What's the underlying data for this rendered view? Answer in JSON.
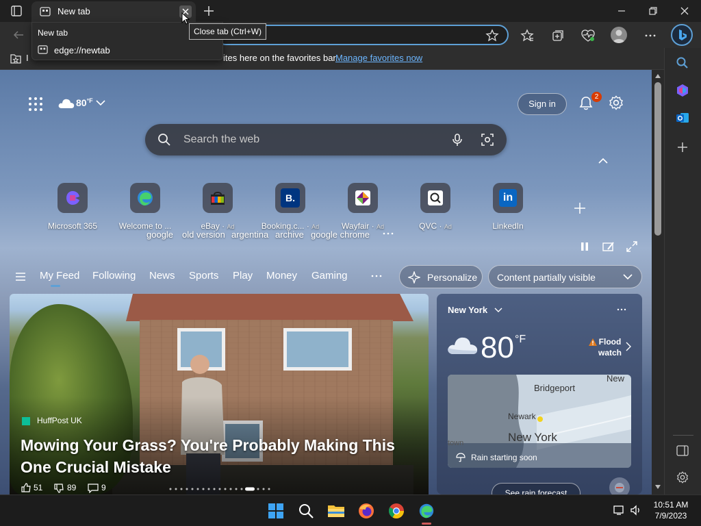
{
  "tab": {
    "title": "New tab"
  },
  "dropdown": {
    "title": "New tab",
    "url": "edge://newtab"
  },
  "tooltip": "Close tab (Ctrl+W)",
  "favbar": {
    "text_prefix": "I",
    "text": "ites here on the favorites bar.",
    "link": "Manage favorites now"
  },
  "header": {
    "weather_temp": "80",
    "weather_unit": "°F",
    "sign_in": "Sign in",
    "notif_count": "2"
  },
  "search": {
    "placeholder": "Search the web"
  },
  "suggestions": [
    "google",
    "old version",
    "argentina",
    "archive",
    "google chrome"
  ],
  "shortcuts": [
    {
      "label": "Microsoft 365",
      "ad": ""
    },
    {
      "label": "Welcome to ...",
      "ad": ""
    },
    {
      "label": "eBay",
      "ad": "Ad"
    },
    {
      "label": "Booking.c...",
      "ad": "Ad"
    },
    {
      "label": "Wayfair",
      "ad": "Ad"
    },
    {
      "label": "QVC",
      "ad": "Ad"
    },
    {
      "label": "LinkedIn",
      "ad": ""
    }
  ],
  "feed": {
    "tabs": [
      "My Feed",
      "Following",
      "News",
      "Sports",
      "Play",
      "Money",
      "Gaming"
    ],
    "personalize": "Personalize",
    "visibility": "Content partially visible"
  },
  "article": {
    "source": "HuffPost UK",
    "headline_1": "Mowing Your Grass? You're Probably Making This",
    "headline_2": "One Crucial Mistake",
    "likes": "51",
    "dislikes": "89",
    "comments": "9"
  },
  "weather": {
    "city": "New York",
    "temp": "80",
    "unit": "°F",
    "alert_1": "Flood",
    "alert_2": "watch",
    "map_labels": [
      "Bridgeport",
      "New",
      "Newark",
      "New York",
      "town"
    ],
    "rain": "Rain starting soon",
    "forecast_btn": "See rain forecast"
  },
  "clock": {
    "time": "10:51 AM",
    "date": "7/9/2023"
  },
  "colors": {
    "accent": "#5ea0d6",
    "link": "#6cb6ff",
    "badge": "#d83b01"
  }
}
